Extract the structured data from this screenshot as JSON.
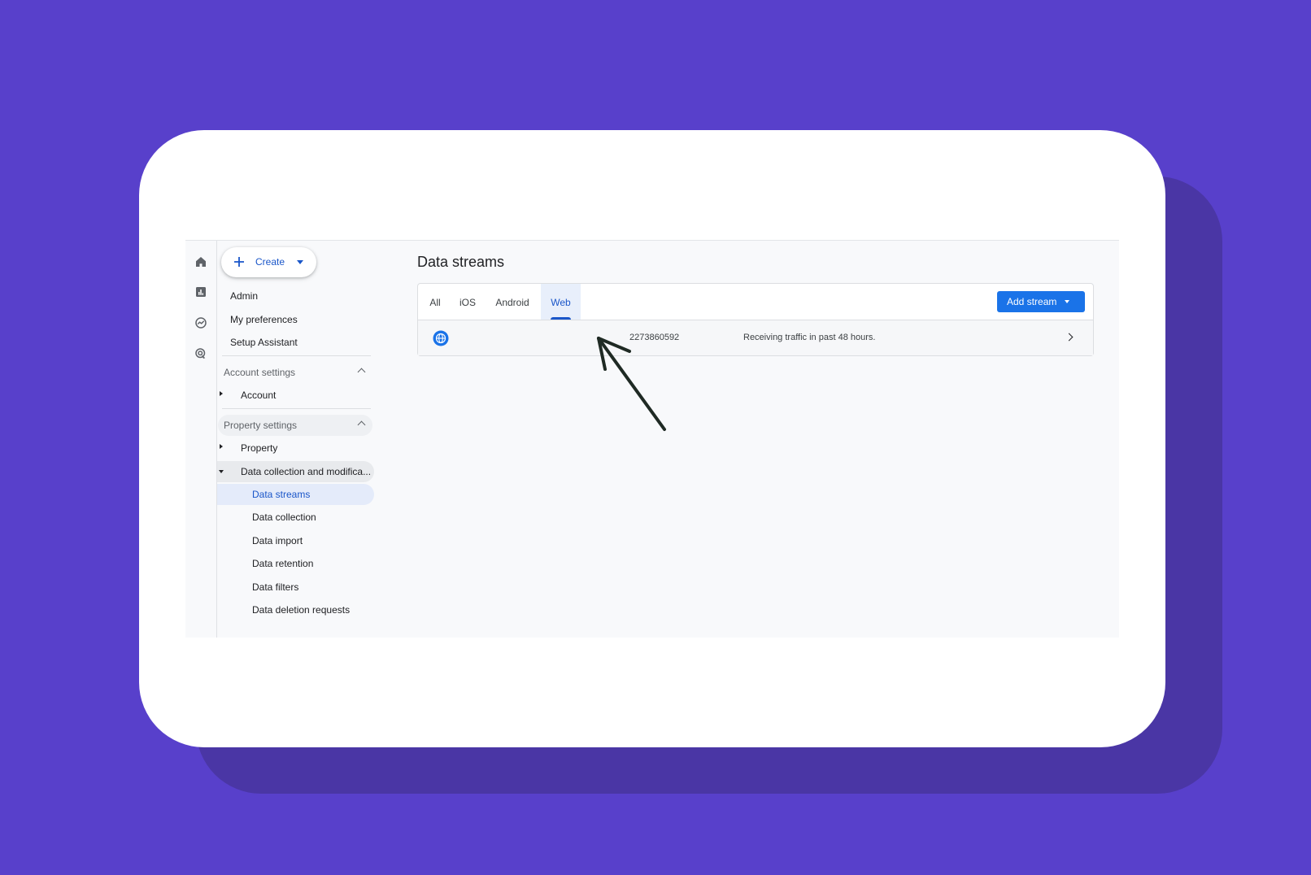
{
  "sidebar": {
    "create_label": "Create",
    "top_items": [
      "Admin",
      "My preferences",
      "Setup Assistant"
    ],
    "account_settings": {
      "header": "Account settings",
      "items": [
        "Account"
      ]
    },
    "property_settings": {
      "header": "Property settings",
      "items": [
        "Property",
        "Data collection and modifica..."
      ],
      "sub_items": [
        "Data streams",
        "Data collection",
        "Data import",
        "Data retention",
        "Data filters",
        "Data deletion requests"
      ],
      "selected": "Data streams"
    }
  },
  "rail": {
    "icons": [
      "home-icon",
      "reports-icon",
      "explore-icon",
      "advertising-icon"
    ]
  },
  "main": {
    "title": "Data streams",
    "tabs": [
      "All",
      "iOS",
      "Android",
      "Web"
    ],
    "active_tab": "Web",
    "add_stream_label": "Add stream",
    "stream": {
      "icon": "globe-icon",
      "id": "2273860592",
      "status": "Receiving traffic in past 48 hours."
    }
  },
  "colors": {
    "background": "#5840cb",
    "accent": "#1a73e8",
    "annotation_arrow": "#1f2a24"
  }
}
